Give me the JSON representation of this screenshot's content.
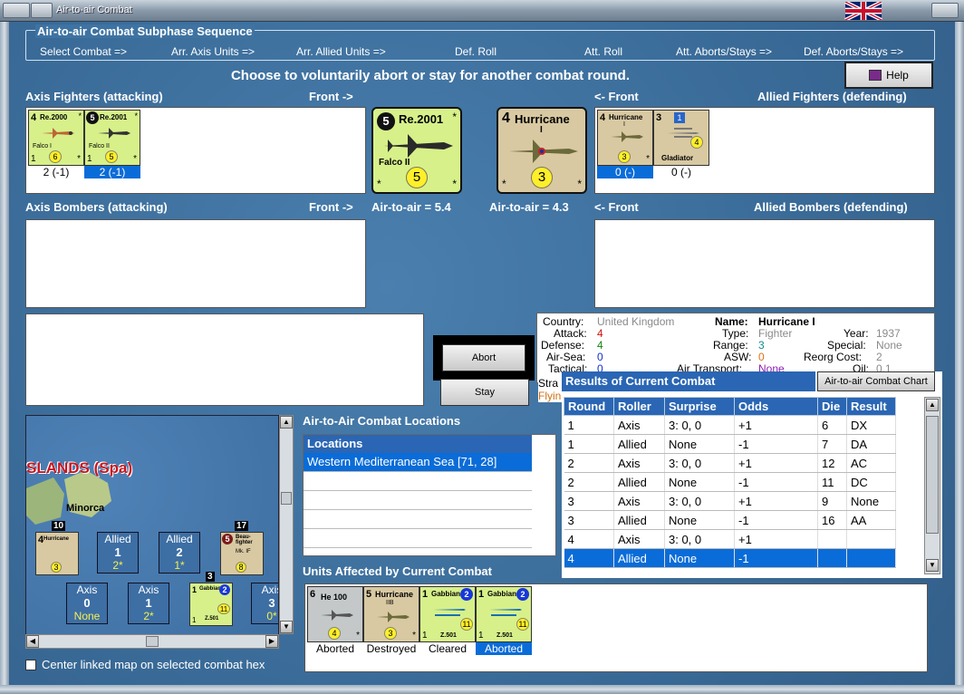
{
  "window": {
    "title": "Air-to-air Combat"
  },
  "sequence": {
    "title": "Air-to-air Combat Subphase Sequence",
    "steps": [
      "Select Combat =>",
      "Arr. Axis Units =>",
      "Arr. Allied Units =>",
      "Def. Roll",
      "Att. Roll",
      "Att. Aborts/Stays =>",
      "Def. Aborts/Stays =>"
    ]
  },
  "instruction": "Choose to voluntarily abort or stay for another combat round.",
  "help_label": "Help",
  "sections": {
    "axis_fighters": "Axis Fighters (attacking)",
    "front_right": "Front ->",
    "front_left": "<- Front",
    "allied_fighters": "Allied Fighters (defending)",
    "axis_bombers": "Axis Bombers (attacking)",
    "allied_bombers": "Allied Bombers (defending)"
  },
  "axis_fighters": [
    {
      "tl": "4",
      "name": "Re.2000",
      "sub": "Falco I",
      "bl": "1",
      "ball": "6",
      "caption": "2 (-1)"
    },
    {
      "tl": "",
      "badge": "5",
      "name": "Re.2001",
      "sub": "Falco II",
      "bl": "1",
      "ball": "5",
      "caption": "2 (-1)"
    }
  ],
  "allied_fighters": [
    {
      "tl": "4",
      "name": "Hurricane",
      "sub": "I",
      "bl": "",
      "ball": "3",
      "caption": "0 (-)"
    },
    {
      "tl": "3",
      "badge": "1",
      "name": "Gladiator",
      "sub": "",
      "bl": "",
      "ball": "4",
      "caption": "0 (-)"
    }
  ],
  "attacker_big": {
    "badge": "5",
    "name": "Re.2001",
    "sub": "Falco II",
    "ball": "5"
  },
  "defender_big": {
    "num": "4",
    "name": "Hurricane",
    "sub": "I",
    "ball": "3"
  },
  "air_to_air_att": "Air-to-air = 5.4",
  "air_to_air_def": "Air-to-air = 4.3",
  "buttons": {
    "abort": "Abort",
    "stay": "Stay",
    "chart": "Air-to-air Combat Chart"
  },
  "unit_info": {
    "country_label": "Country:",
    "country": "United Kingdom",
    "attack_label": "Attack:",
    "attack": "4",
    "defense_label": "Defense:",
    "defense": "4",
    "airsea_label": "Air-Sea:",
    "airsea": "0",
    "tactical_label": "Tactical:",
    "tactical": "0",
    "strat_label": "Stra",
    "flying_label": "Flyin",
    "name_label": "Name:",
    "name": "Hurricane I",
    "type_label": "Type:",
    "type": "Fighter",
    "range_label": "Range:",
    "range": "3",
    "asw_label": "ASW:",
    "asw": "0",
    "airtransport_label": "Air Transport:",
    "airtransport": "None",
    "year_label": "Year:",
    "year": "1937",
    "special_label": "Special:",
    "special": "None",
    "reorg_label": "Reorg Cost:",
    "reorg": "2",
    "oil_label": "Oil:",
    "oil": "0.1"
  },
  "results": {
    "title": "Results of Current Combat",
    "columns": [
      "Round",
      "Roller",
      "Surprise",
      "Odds",
      "Die",
      "Result"
    ],
    "rows": [
      [
        "1",
        "Axis",
        "3: 0, 0",
        "+1",
        "6",
        "DX"
      ],
      [
        "1",
        "Allied",
        "None",
        "-1",
        "7",
        "DA"
      ],
      [
        "2",
        "Axis",
        "3: 0, 0",
        "+1",
        "12",
        "AC"
      ],
      [
        "2",
        "Allied",
        "None",
        "-1",
        "11",
        "DC"
      ],
      [
        "3",
        "Axis",
        "3: 0, 0",
        "+1",
        "9",
        "None"
      ],
      [
        "3",
        "Allied",
        "None",
        "-1",
        "16",
        "AA"
      ],
      [
        "4",
        "Axis",
        "3: 0, 0",
        "+1",
        "",
        ""
      ],
      [
        "4",
        "Allied",
        "None",
        "-1",
        "",
        ""
      ]
    ]
  },
  "locations": {
    "title": "Air-to-Air Combat Locations",
    "header": "Locations",
    "items": [
      "Western Mediterranean Sea [71, 28]"
    ]
  },
  "affected": {
    "title": "Units Affected by Current Combat",
    "units": [
      {
        "tl": "6",
        "name": "He 100",
        "ball": "4",
        "caption": "Aborted"
      },
      {
        "tl": "5",
        "name": "Hurricane",
        "sub": "IIB",
        "ball": "3",
        "caption": "Destroyed"
      },
      {
        "tl": "1",
        "badge": "2",
        "name": "Gabbiano",
        "sub": "Z.501",
        "ball": "11",
        "bl": "1",
        "caption": "Cleared"
      },
      {
        "tl": "1",
        "badge": "2",
        "name": "Gabbiano",
        "sub": "Z.501",
        "ball": "11",
        "bl": "1",
        "caption": "Aborted"
      }
    ]
  },
  "map": {
    "region": "SLANDS (Spa)",
    "island": "Minorca",
    "tag_10": "10",
    "tag_17": "17",
    "tag_3": "3",
    "unit_hurricane": {
      "tl": "4",
      "name": "Hurricane",
      "ball": "3"
    },
    "unit_beau": {
      "badge": "5",
      "name": "Beau-fighter",
      "sub": "Mk. IF",
      "ball": "8"
    },
    "unit_gabbiano": {
      "tl": "1",
      "badge": "2",
      "name": "Gabbiano",
      "sub": "Z.501",
      "ball": "11",
      "bl": "1"
    },
    "zones": [
      {
        "side": "Allied",
        "value": "1",
        "sub": "2*"
      },
      {
        "side": "Allied",
        "value": "2",
        "sub": "1*"
      },
      {
        "side": "Axis",
        "value": "0",
        "sub": "None"
      },
      {
        "side": "Axis",
        "value": "1",
        "sub": "2*"
      },
      {
        "side": "Axis",
        "value": "3",
        "sub": "0*"
      }
    ]
  },
  "center_map_label": "Center linked map on selected combat hex"
}
